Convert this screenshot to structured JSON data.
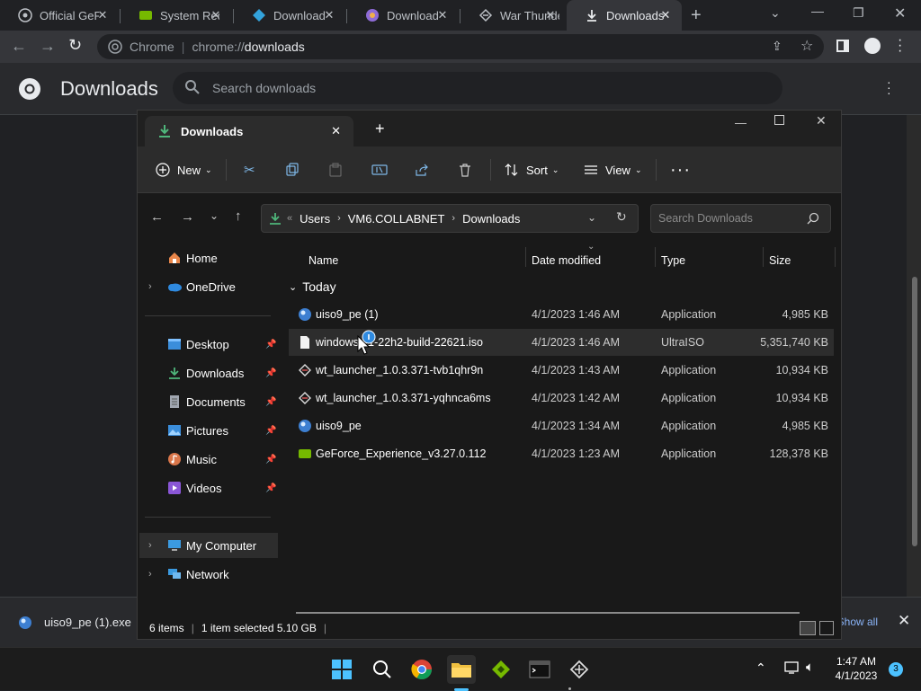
{
  "browser": {
    "tabs": [
      {
        "label": "Official GeForce Drivers",
        "icon": "nvidia-icon"
      },
      {
        "label": "System Requirements",
        "icon": "nvidia-icon"
      },
      {
        "label": "Download",
        "icon": "download-icon"
      },
      {
        "label": "Download",
        "icon": "globe-icon"
      },
      {
        "label": "War Thunder",
        "icon": "warthunder-icon"
      },
      {
        "label": "Downloads",
        "icon": "download-icon"
      }
    ],
    "omnibox": {
      "chip": "Chrome",
      "url_prefix": "chrome://",
      "url_path": "downloads"
    }
  },
  "downloads_page": {
    "title": "Downloads",
    "search_placeholder": "Search downloads"
  },
  "download_bar": {
    "file": "uiso9_pe (1).exe",
    "show_all": "Show all"
  },
  "explorer": {
    "tab_title": "Downloads",
    "commands": {
      "new": "New",
      "sort": "Sort",
      "view": "View"
    },
    "breadcrumb": [
      "Users",
      "VM6.COLLABNET",
      "Downloads"
    ],
    "search_placeholder": "Search Downloads",
    "nav": {
      "home": "Home",
      "onedrive": "OneDrive",
      "desktop": "Desktop",
      "downloads": "Downloads",
      "documents": "Documents",
      "pictures": "Pictures",
      "music": "Music",
      "videos": "Videos",
      "my_computer": "My Computer",
      "network": "Network"
    },
    "columns": {
      "name": "Name",
      "date": "Date modified",
      "type": "Type",
      "size": "Size"
    },
    "group": "Today",
    "files": [
      {
        "name": "uiso9_pe (1)",
        "date": "4/1/2023 1:46 AM",
        "type": "Application",
        "size": "4,985 KB"
      },
      {
        "name": "windows-11-22h2-build-22621.iso",
        "date": "4/1/2023 1:46 AM",
        "type": "UltraISO",
        "size": "5,351,740 KB"
      },
      {
        "name": "wt_launcher_1.0.3.371-tvb1qhr9n",
        "date": "4/1/2023 1:43 AM",
        "type": "Application",
        "size": "10,934 KB"
      },
      {
        "name": "wt_launcher_1.0.3.371-yqhnca6ms",
        "date": "4/1/2023 1:42 AM",
        "type": "Application",
        "size": "10,934 KB"
      },
      {
        "name": "uiso9_pe",
        "date": "4/1/2023 1:34 AM",
        "type": "Application",
        "size": "4,985 KB"
      },
      {
        "name": "GeForce_Experience_v3.27.0.112",
        "date": "4/1/2023 1:23 AM",
        "type": "Application",
        "size": "128,378 KB"
      }
    ],
    "status": {
      "items": "6 items",
      "selected": "1 item selected  5.10 GB"
    }
  },
  "taskbar": {
    "time": "1:47 AM",
    "date": "4/1/2023",
    "notifications": "3"
  }
}
